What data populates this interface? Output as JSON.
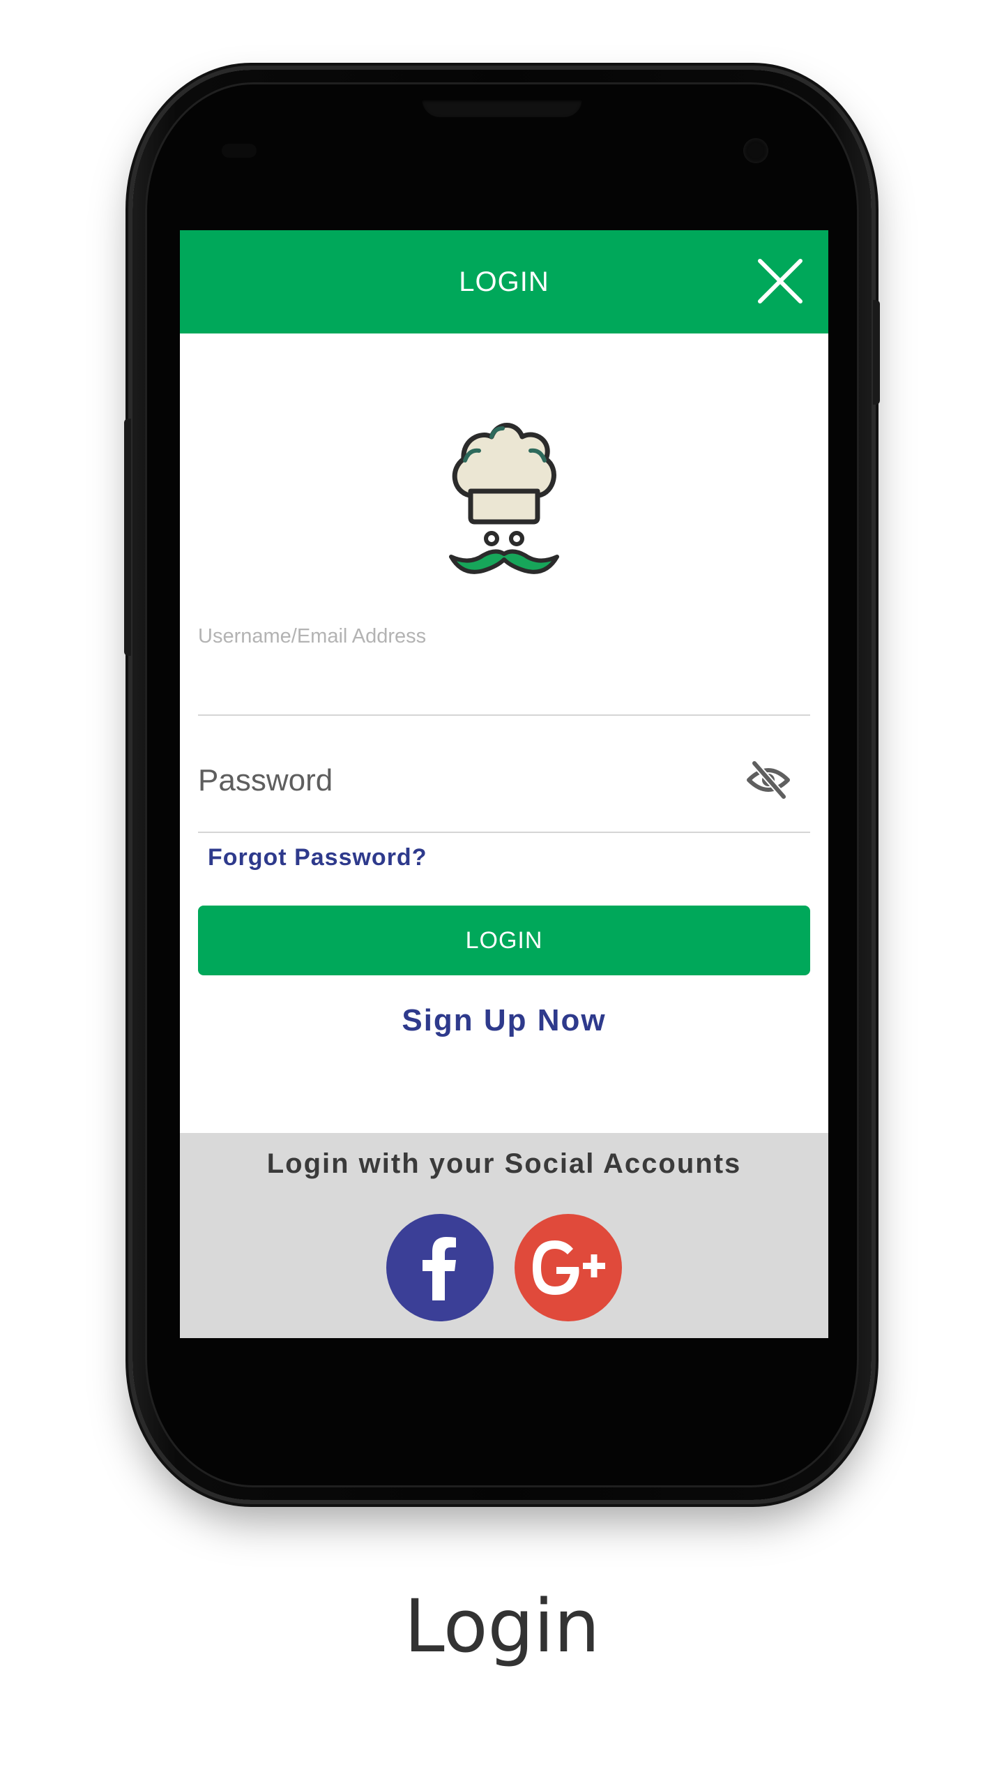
{
  "header": {
    "title": "LOGIN"
  },
  "form": {
    "username_label": "Username/Email Address",
    "username_value": "",
    "password_placeholder": "Password",
    "forgot_password": "Forgot Password?",
    "login_button": "LOGIN",
    "signup_link": "Sign Up Now"
  },
  "social": {
    "title": "Login with your Social Accounts",
    "buttons": [
      "facebook-icon",
      "google-plus-icon"
    ]
  },
  "caption": "Login",
  "colors": {
    "primary_green": "#00a85a",
    "link_blue": "#2e3a8c",
    "facebook": "#3b3f97",
    "google": "#e04a3b",
    "social_panel_bg": "#d9d9d9"
  }
}
